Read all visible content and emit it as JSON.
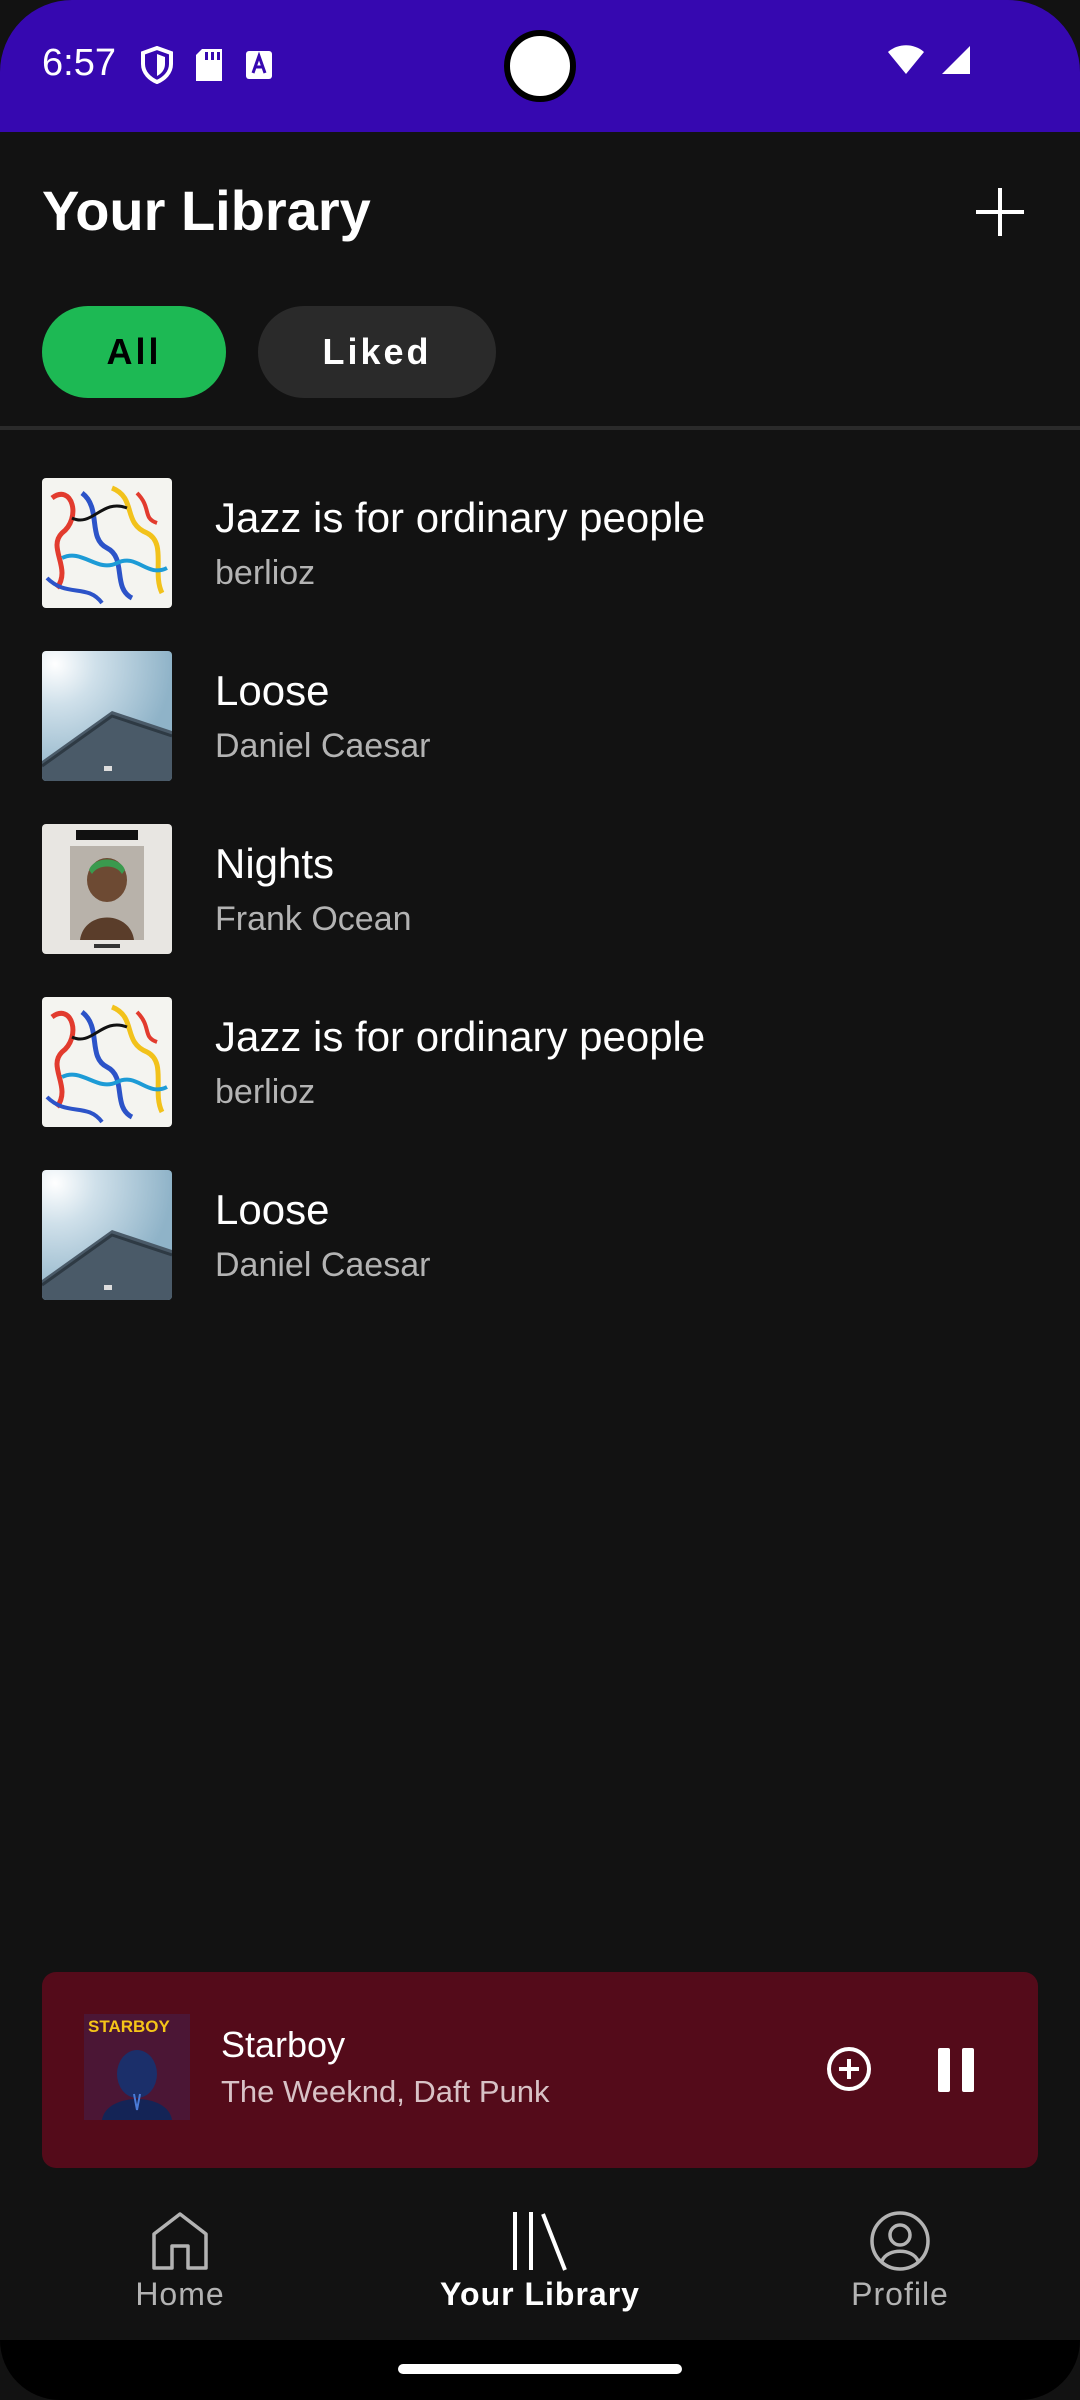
{
  "status_bar": {
    "time": "6:57",
    "background": "#3608b0"
  },
  "header": {
    "title": "Your Library",
    "add_icon": "plus-icon"
  },
  "filters": {
    "chips": [
      {
        "label": "All",
        "active": true
      },
      {
        "label": "Liked",
        "active": false
      }
    ],
    "accent": "#1db954"
  },
  "library": {
    "items": [
      {
        "title": "Jazz is for ordinary people",
        "subtitle": "berlioz",
        "cover": "jazz-cover"
      },
      {
        "title": "Loose",
        "subtitle": "Daniel Caesar",
        "cover": "loose-cover"
      },
      {
        "title": "Nights",
        "subtitle": "Frank Ocean",
        "cover": "blond-cover"
      },
      {
        "title": "Jazz is for ordinary people",
        "subtitle": "berlioz",
        "cover": "jazz-cover"
      },
      {
        "title": "Loose",
        "subtitle": "Daniel Caesar",
        "cover": "loose-cover"
      }
    ]
  },
  "now_playing": {
    "title": "Starboy",
    "artist": "The Weeknd, Daft Punk",
    "cover_text": "STARBOY",
    "background": "#540b1a",
    "add_icon": "add-circle-icon",
    "pause_icon": "pause-icon"
  },
  "nav": {
    "items": [
      {
        "label": "Home",
        "icon": "home-icon",
        "active": false
      },
      {
        "label": "Your Library",
        "icon": "library-icon",
        "active": true
      },
      {
        "label": "Profile",
        "icon": "profile-icon",
        "active": false
      }
    ]
  }
}
